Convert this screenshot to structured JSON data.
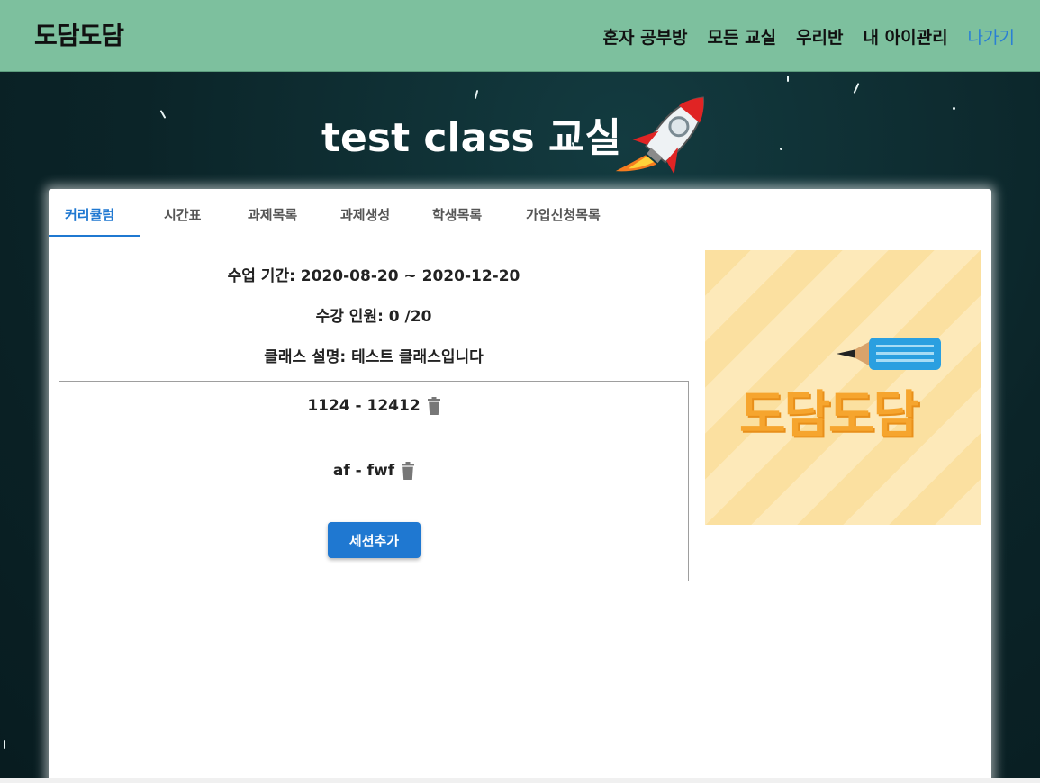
{
  "navbar": {
    "brand": "도담도담",
    "links": [
      {
        "label": "혼자 공부방"
      },
      {
        "label": "모든 교실"
      },
      {
        "label": "우리반"
      },
      {
        "label": "내 아이관리"
      },
      {
        "label": "나가기"
      }
    ],
    "colors": {
      "background": "#7dc09e",
      "exit_link": "#2a7fd4"
    }
  },
  "hero": {
    "title": "test class 교실",
    "icon": "rocket-icon"
  },
  "tabs": [
    {
      "label": "커리큘럼",
      "active": true
    },
    {
      "label": "시간표"
    },
    {
      "label": "과제목록"
    },
    {
      "label": "과제생성"
    },
    {
      "label": "학생목록"
    },
    {
      "label": "가입신청목록"
    }
  ],
  "course": {
    "period": "수업 기간: 2020-08-20 ~ 2020-12-20",
    "enrollment": "수강 인원: 0 /20",
    "description": "클래스 설명: 테스트 클래스입니다"
  },
  "sessions": [
    {
      "label": "1124 - 12412",
      "icon": "trash-icon"
    },
    {
      "label": "af - fwf",
      "icon": "trash-icon"
    }
  ],
  "add_session_label": "세션추가",
  "logo": {
    "text": "도담도담",
    "icon": "pencil-icon"
  },
  "colors": {
    "accent": "#1f78d1",
    "background": "#0d2a2e",
    "logo": "#f6a52e"
  }
}
